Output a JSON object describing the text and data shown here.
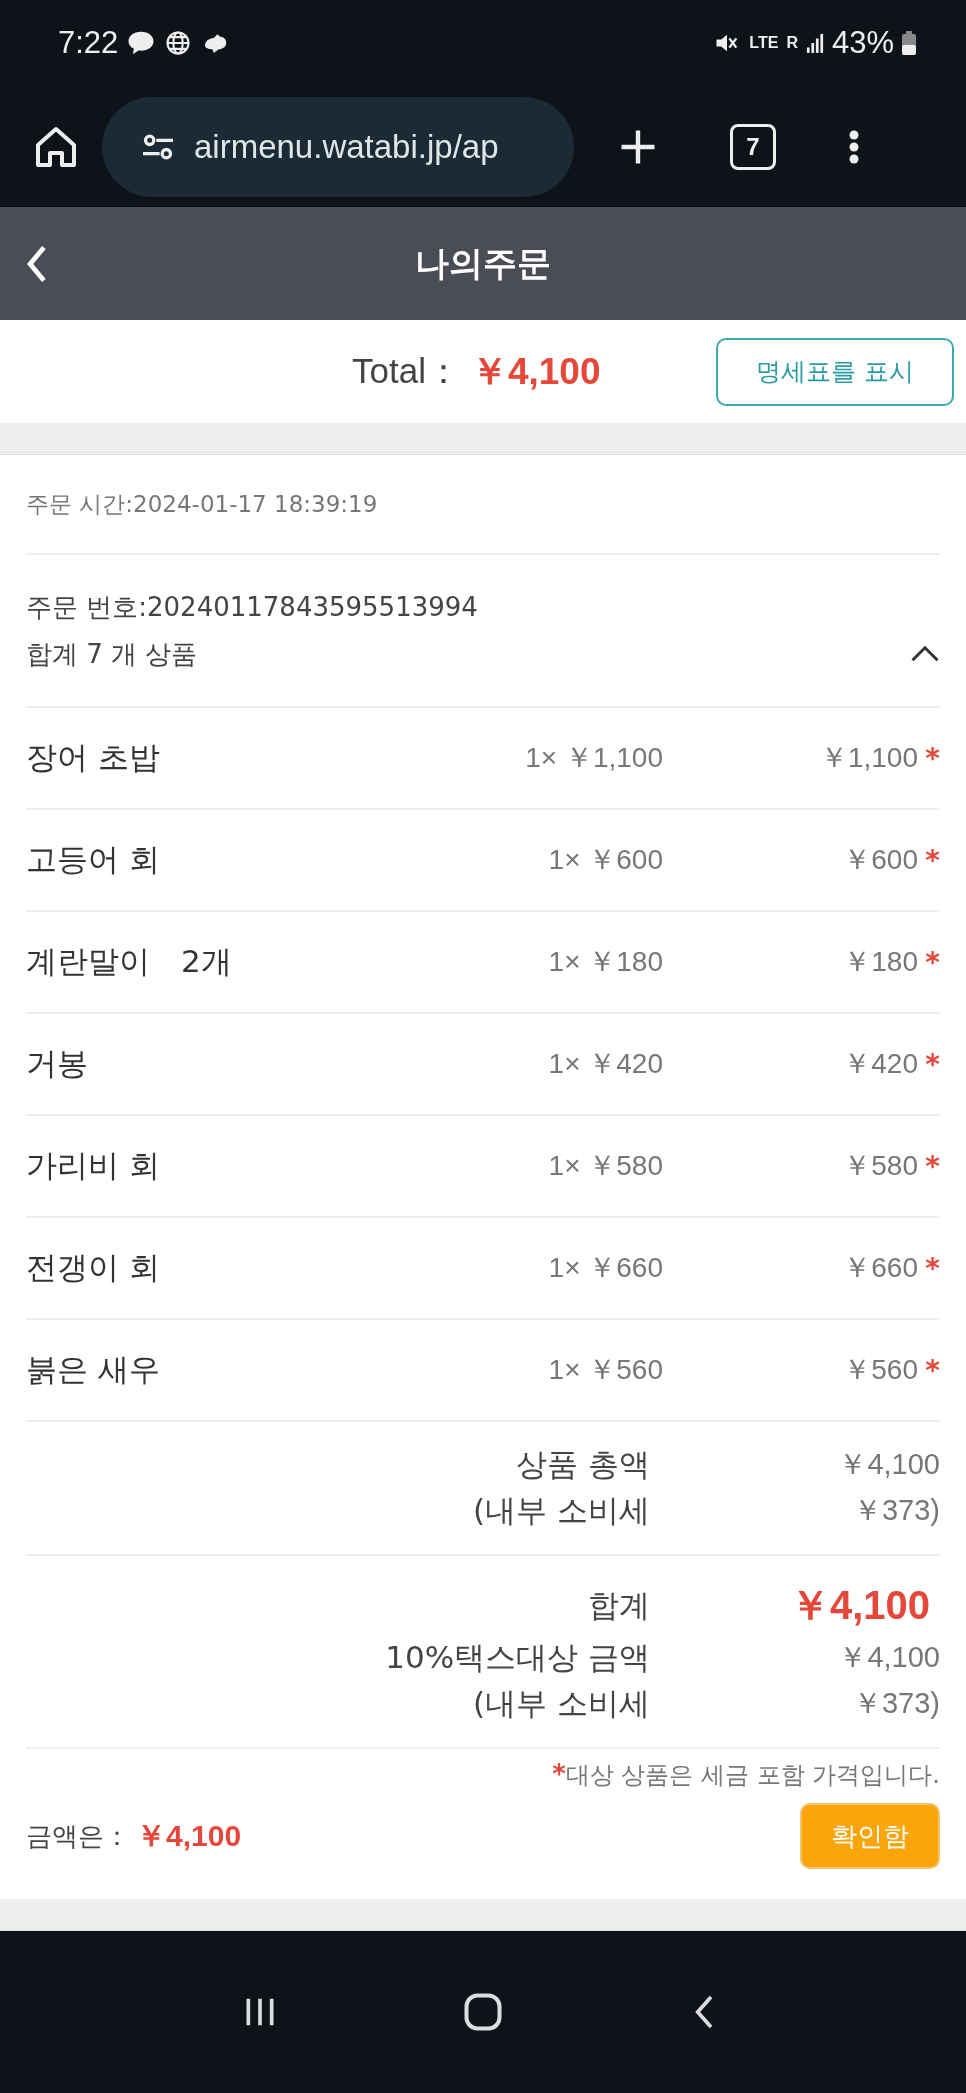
{
  "status_bar": {
    "time": "7:22",
    "network": "LTE",
    "roaming": "R",
    "battery": "43%"
  },
  "browser": {
    "url": "airmenu.watabi.jp/ap",
    "tab_count": "7"
  },
  "header": {
    "title": "나의주문"
  },
  "total_bar": {
    "label": "Total：",
    "amount": "￥4,100",
    "button": "명세표를 표시"
  },
  "order": {
    "time": "주문 시간:2024-01-17 18:39:19",
    "number": "주문 번호:20240117843595513994",
    "count": "합계 7 개 상품",
    "expanded": true
  },
  "items": [
    {
      "name": "장어 초밥",
      "qty_price": "1× ￥1,100",
      "total": "￥1,100",
      "mark": "*"
    },
    {
      "name": "고등어 회",
      "qty_price": "1× ￥600",
      "total": "￥600",
      "mark": "*"
    },
    {
      "name": "계란말이　2개",
      "qty_price": "1× ￥180",
      "total": "￥180",
      "mark": "*"
    },
    {
      "name": "거봉",
      "qty_price": "1× ￥420",
      "total": "￥420",
      "mark": "*"
    },
    {
      "name": "가리비 회",
      "qty_price": "1× ￥580",
      "total": "￥580",
      "mark": "*"
    },
    {
      "name": "전갱이 회",
      "qty_price": "1× ￥660",
      "total": "￥660",
      "mark": "*"
    },
    {
      "name": "붉은 새우",
      "qty_price": "1× ￥560",
      "total": "￥560",
      "mark": "*"
    }
  ],
  "subtotal": [
    {
      "label": "상품 총액",
      "value": "￥4,100"
    },
    {
      "label": "(내부 소비세",
      "value": "￥373)"
    }
  ],
  "grand_total": [
    {
      "label": "합계",
      "value": "￥4,100",
      "kind": "highlight"
    },
    {
      "label": "10%택스대상 금액",
      "value": "￥4,100",
      "kind": "plain"
    },
    {
      "label": "(내부 소비세",
      "value": "￥373)",
      "kind": "plain"
    }
  ],
  "note": {
    "mark": "*",
    "text": "대상 상품은 세금 포함 가격입니다."
  },
  "footer": {
    "label": "금액은：",
    "amount": "￥4,100",
    "button": "확인함"
  }
}
